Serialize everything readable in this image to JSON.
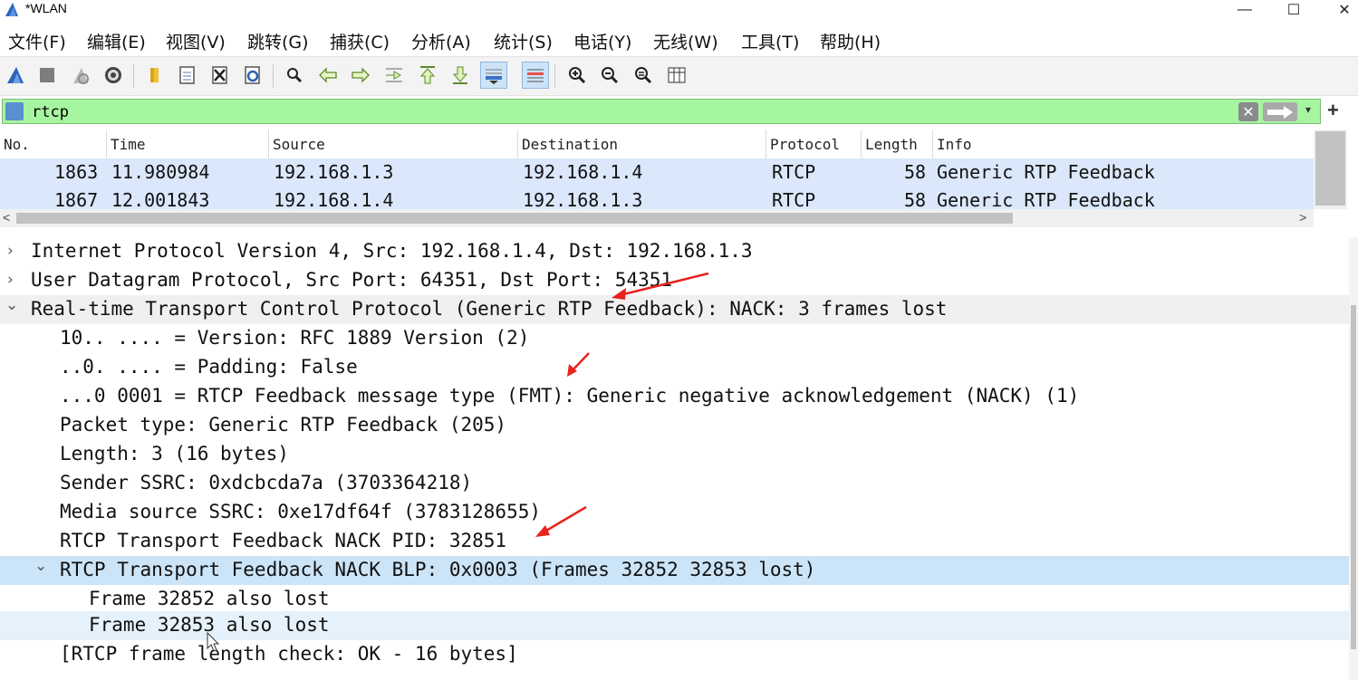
{
  "window": {
    "title": "*WLAN",
    "minimize": "—",
    "maximize": "☐",
    "close": "✕"
  },
  "menu": [
    {
      "label": "文件(F)"
    },
    {
      "label": "编辑(E)"
    },
    {
      "label": "视图(V)"
    },
    {
      "label": "跳转(G)"
    },
    {
      "label": "捕获(C)"
    },
    {
      "label": "分析(A)"
    },
    {
      "label": "统计(S)"
    },
    {
      "label": "电话(Y)"
    },
    {
      "label": "无线(W)"
    },
    {
      "label": "工具(T)"
    },
    {
      "label": "帮助(H)"
    }
  ],
  "toolbar": {
    "icons": [
      "shark-fin-icon",
      "stop-icon",
      "restart-icon",
      "options-gear-icon",
      "open-folder-icon",
      "file-icon",
      "close-file-icon",
      "reload-icon",
      "find-icon",
      "back-arrow-icon",
      "forward-arrow-icon",
      "go-to-packet-icon",
      "first-packet-icon",
      "last-packet-icon",
      "autoscroll-icon",
      "colorize-icon",
      "zoom-in-icon",
      "zoom-out-icon",
      "zoom-normal-icon",
      "resize-columns-icon"
    ]
  },
  "filter": {
    "value": "rtcp",
    "clear": "✕",
    "dropdown": "▾",
    "add": "+"
  },
  "packet_list": {
    "columns": [
      "No.",
      "Time",
      "Source",
      "Destination",
      "Protocol",
      "Length",
      "Info"
    ],
    "rows": [
      {
        "no": "1863",
        "time": "11.980984",
        "source": "192.168.1.3",
        "destination": "192.168.1.4",
        "protocol": "RTCP",
        "length": "58",
        "info": "Generic RTP Feedback"
      },
      {
        "no": "1867",
        "time": "12.001843",
        "source": "192.168.1.4",
        "destination": "192.168.1.3",
        "protocol": "RTCP",
        "length": "58",
        "info": "Generic RTP Feedback"
      }
    ],
    "scroll_left": "<",
    "scroll_right": ">"
  },
  "details": [
    {
      "text": "Internet Protocol Version 4, Src: 192.168.1.4, Dst: 192.168.1.3",
      "arrow": "›"
    },
    {
      "text": "User Datagram Protocol, Src Port: 64351, Dst Port: 54351",
      "arrow": "›"
    },
    {
      "text": "Real-time Transport Control Protocol (Generic RTP Feedback): NACK: 3 frames lost",
      "arrow": "⌄"
    },
    {
      "text": "10.. .... = Version: RFC 1889 Version (2)"
    },
    {
      "text": "..0. .... = Padding: False"
    },
    {
      "text": "...0 0001 = RTCP Feedback message type (FMT): Generic negative acknowledgement (NACK) (1)"
    },
    {
      "text": "Packet type: Generic RTP Feedback (205)"
    },
    {
      "text": "Length: 3 (16 bytes)"
    },
    {
      "text": "Sender SSRC: 0xdcbcda7a (3703364218)"
    },
    {
      "text": "Media source SSRC: 0xe17df64f (3783128655)"
    },
    {
      "text": "RTCP Transport Feedback NACK PID: 32851"
    },
    {
      "text": "RTCP Transport Feedback NACK BLP: 0x0003 (Frames 32852 32853 lost)",
      "arrow": "⌄"
    },
    {
      "text": "Frame 32852 also lost"
    },
    {
      "text": "Frame 32853 also lost"
    },
    {
      "text": "[RTCP frame length check: OK - 16 bytes]"
    }
  ],
  "colors": {
    "filter_valid": "#a6f5a0",
    "selected_row": "#cce4f7",
    "packet_row": "#dbe8fb",
    "annotation_arrow": "#e8221c"
  }
}
